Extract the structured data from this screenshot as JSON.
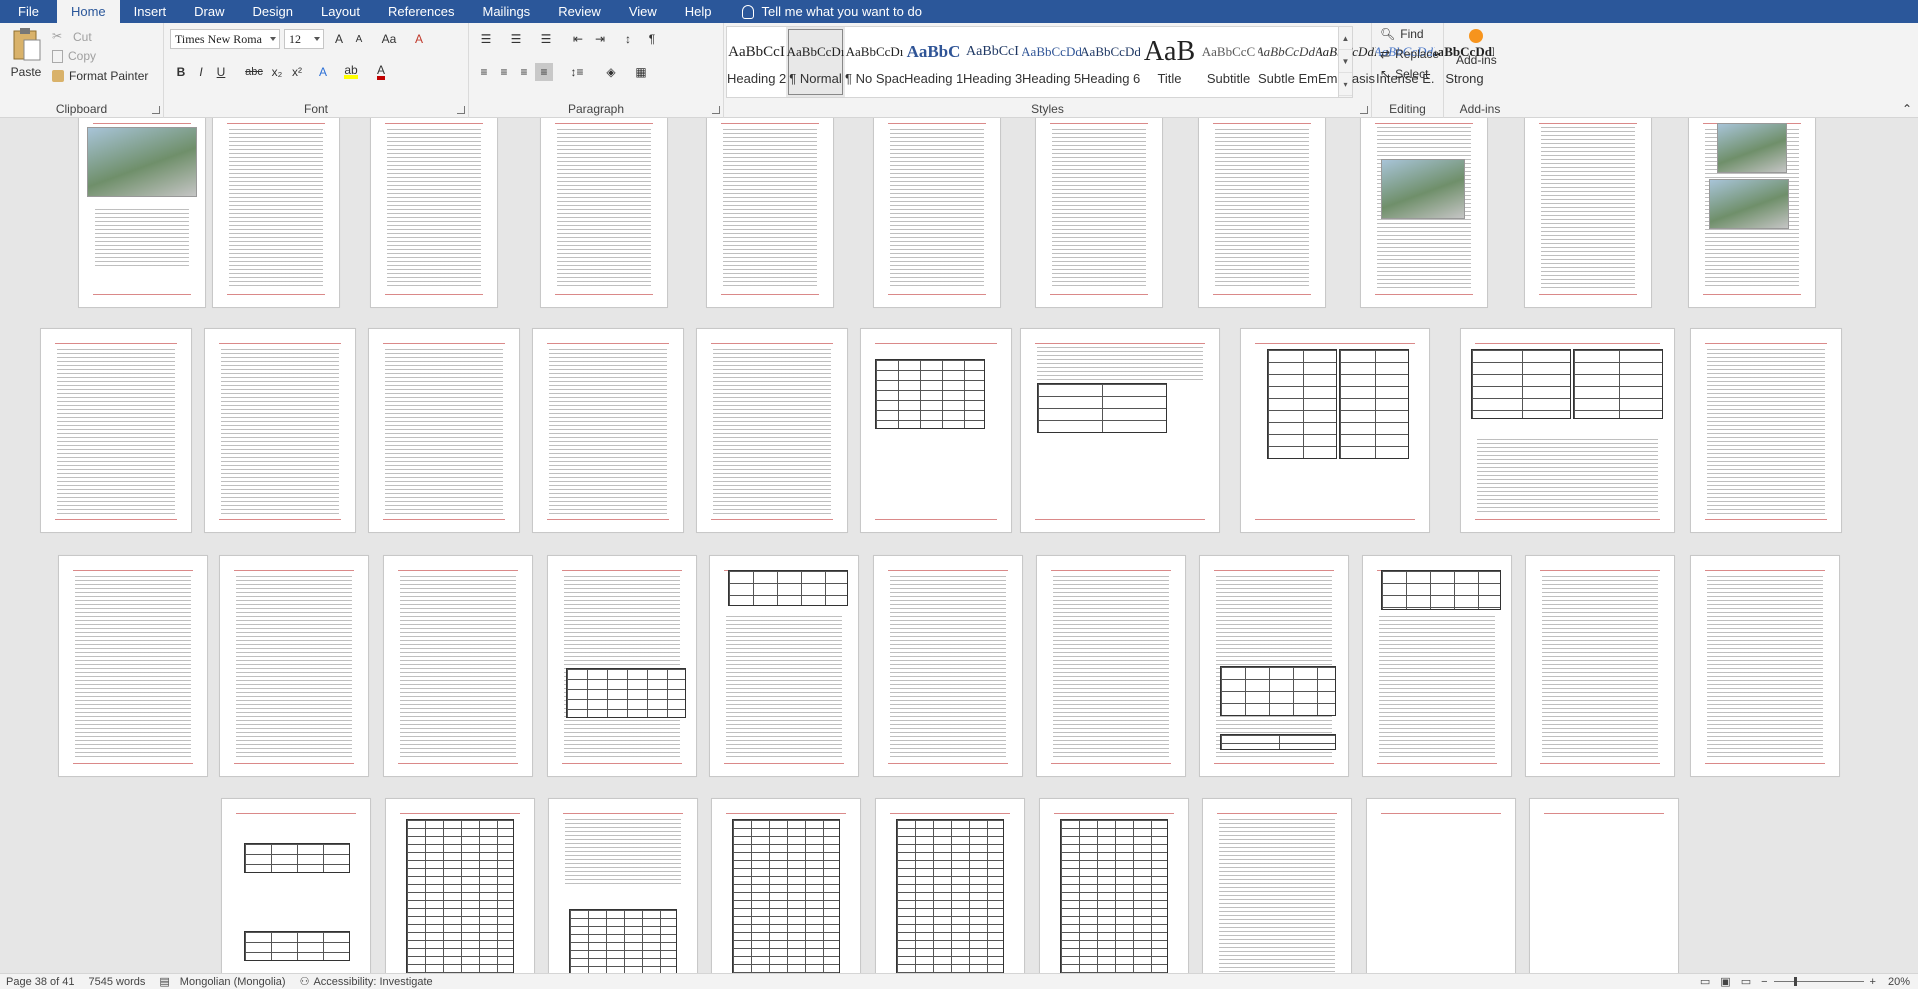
{
  "tabs": {
    "file": "File",
    "home": "Home",
    "insert": "Insert",
    "draw": "Draw",
    "design": "Design",
    "layout": "Layout",
    "references": "References",
    "mailings": "Mailings",
    "review": "Review",
    "view": "View",
    "help": "Help",
    "tell_me": "Tell me what you want to do"
  },
  "clipboard": {
    "paste": "Paste",
    "cut": "Cut",
    "copy": "Copy",
    "format_painter": "Format Painter",
    "label": "Clipboard"
  },
  "font": {
    "family": "Times New Roma",
    "size": "12",
    "label": "Font",
    "bold": "B",
    "italic": "I",
    "underline": "U",
    "strike": "abc",
    "subscript": "x₂",
    "superscript": "x²",
    "grow": "A",
    "shrink": "A",
    "change_case": "Aa"
  },
  "paragraph": {
    "label": "Paragraph"
  },
  "styles": {
    "label": "Styles",
    "items": [
      {
        "sample": "AaBbCcI",
        "name": "Heading 2"
      },
      {
        "sample": "AaBbCcDı",
        "name": "¶ Normal"
      },
      {
        "sample": "AaBbCcDı",
        "name": "¶ No Spac..."
      },
      {
        "sample": "AaBbC",
        "name": "Heading 1"
      },
      {
        "sample": "AaBbCcI",
        "name": "Heading 3"
      },
      {
        "sample": "AaBbCcDd",
        "name": "Heading 5"
      },
      {
        "sample": "AaBbCcDd",
        "name": "Heading 6"
      },
      {
        "sample": "AaB",
        "name": "Title"
      },
      {
        "sample": "AaBbCcC",
        "name": "Subtitle"
      },
      {
        "sample": "AaBbCcDdI",
        "name": "Subtle Em..."
      },
      {
        "sample": "AaBbCcDdI",
        "name": "Emphasis"
      },
      {
        "sample": "AaBbCcDdI",
        "name": "Intense E..."
      },
      {
        "sample": "AaBbCcDdE",
        "name": "Strong"
      }
    ]
  },
  "editing": {
    "label": "Editing",
    "find": "Find",
    "replace": "Replace",
    "select": "Select"
  },
  "addins": {
    "button": "Add-ins",
    "label": "Add-ins"
  },
  "status": {
    "page": "Page 38 of 41",
    "words": "7545 words",
    "language": "Mongolian (Mongolia)",
    "accessibility": "Accessibility: Investigate",
    "zoom": "20%"
  },
  "colors": {
    "ribbon_blue": "#2b579a",
    "highlight": "#ffff00",
    "font_color": "#c00000",
    "addins_accent": "#f7941d"
  }
}
